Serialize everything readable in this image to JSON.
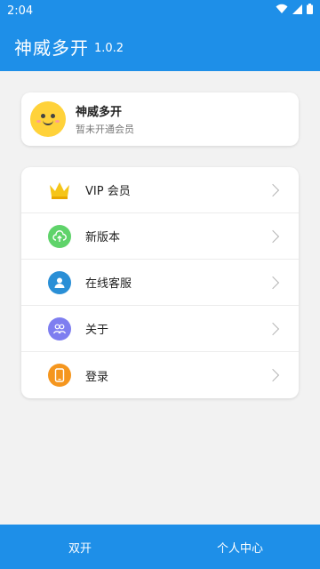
{
  "status_bar": {
    "time": "2:04",
    "icons": [
      "wifi-icon",
      "signal-icon",
      "battery-icon"
    ]
  },
  "app_bar": {
    "title": "神威多开",
    "version": "1.0.2"
  },
  "profile": {
    "name": "神威多开",
    "subtitle": "暂未开通会员",
    "avatar_icon": "smiley-face-icon"
  },
  "menu": [
    {
      "label": "VIP 会员",
      "icon": "crown-icon",
      "color": "#f5c518"
    },
    {
      "label": "新版本",
      "icon": "cloud-upload-icon",
      "color": "#5fd36a"
    },
    {
      "label": "在线客服",
      "icon": "user-service-icon",
      "color": "#2a8fd6"
    },
    {
      "label": "关于",
      "icon": "about-people-icon",
      "color": "#7e7ef0"
    },
    {
      "label": "登录",
      "icon": "phone-login-icon",
      "color": "#f5961e"
    }
  ],
  "bottom_tabs": [
    {
      "label": "双开"
    },
    {
      "label": "个人中心"
    }
  ],
  "colors": {
    "primary": "#1e8fe8",
    "background": "#f2f2f2"
  }
}
